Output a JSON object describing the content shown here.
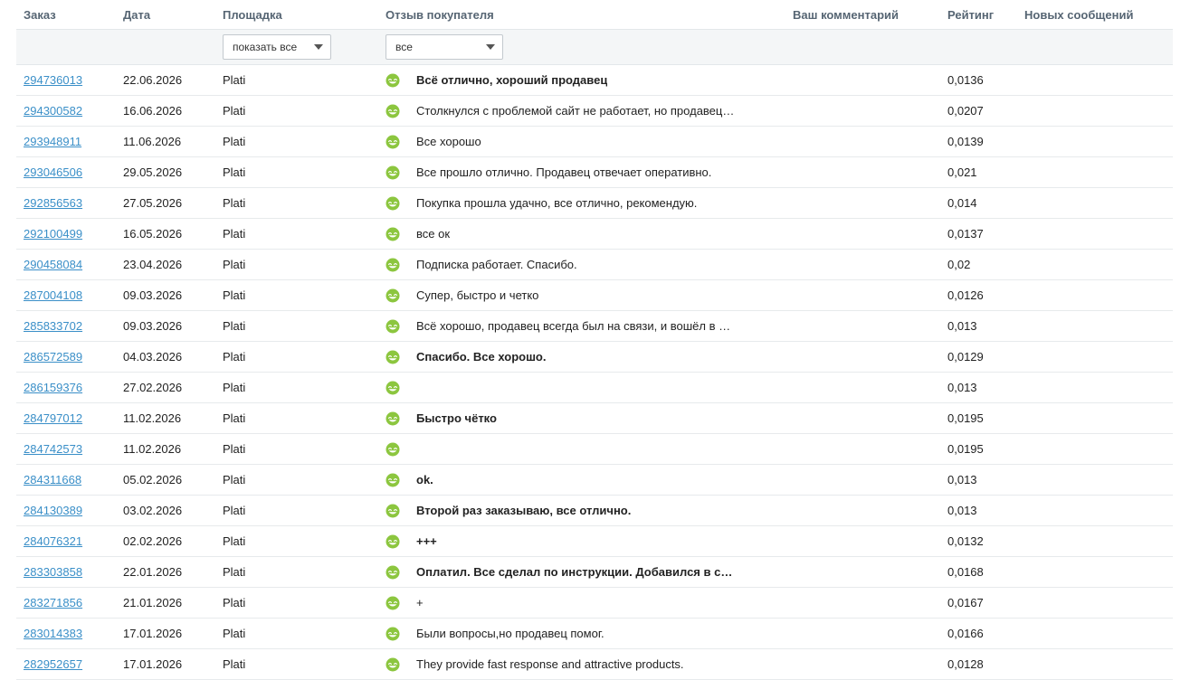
{
  "columns": {
    "order": "Заказ",
    "date": "Дата",
    "platform": "Площадка",
    "feedback": "Отзыв покупателя",
    "comment": "Ваш комментарий",
    "rating": "Рейтинг",
    "messages": "Новых сообщений"
  },
  "filters": {
    "platform": "показать все",
    "feedback": "все"
  },
  "icon": "smiley-positive-icon",
  "colors": {
    "link": "#3a8fc8",
    "smiley": "#8cc63f"
  },
  "rows": [
    {
      "order": "294736013",
      "date": "22.06.2026",
      "platform": "Plati",
      "feedback": "Всё отлично, хороший продавец",
      "bold": true,
      "rating": "0,0136"
    },
    {
      "order": "294300582",
      "date": "16.06.2026",
      "platform": "Plati",
      "feedback": "Столкнулся с проблемой сайт не работает, но продавец помог",
      "bold": false,
      "rating": "0,0207"
    },
    {
      "order": "293948911",
      "date": "11.06.2026",
      "platform": "Plati",
      "feedback": "Все хорошо",
      "bold": false,
      "rating": "0,0139"
    },
    {
      "order": "293046506",
      "date": "29.05.2026",
      "platform": "Plati",
      "feedback": "Все прошло отлично. Продавец отвечает оперативно.",
      "bold": false,
      "rating": "0,021"
    },
    {
      "order": "292856563",
      "date": "27.05.2026",
      "platform": "Plati",
      "feedback": "Покупка прошла удачно, все отлично, рекомендую.",
      "bold": false,
      "rating": "0,014"
    },
    {
      "order": "292100499",
      "date": "16.05.2026",
      "platform": "Plati",
      "feedback": "все ок",
      "bold": false,
      "rating": "0,0137"
    },
    {
      "order": "290458084",
      "date": "23.04.2026",
      "platform": "Plati",
      "feedback": "Подписка работает. Спасибо.",
      "bold": false,
      "rating": "0,02"
    },
    {
      "order": "287004108",
      "date": "09.03.2026",
      "platform": "Plati",
      "feedback": "Супер, быстро и четко",
      "bold": false,
      "rating": "0,0126"
    },
    {
      "order": "285833702",
      "date": "09.03.2026",
      "platform": "Plati",
      "feedback": "Всё хорошо, продавец всегда был на связи, и вошёл в положение",
      "bold": false,
      "rating": "0,013"
    },
    {
      "order": "286572589",
      "date": "04.03.2026",
      "platform": "Plati",
      "feedback": "Спасибо. Все хорошо.",
      "bold": true,
      "rating": "0,0129"
    },
    {
      "order": "286159376",
      "date": "27.02.2026",
      "platform": "Plati",
      "feedback": "",
      "bold": false,
      "rating": "0,013"
    },
    {
      "order": "284797012",
      "date": "11.02.2026",
      "platform": "Plati",
      "feedback": "Быстро чётко",
      "bold": true,
      "rating": "0,0195"
    },
    {
      "order": "284742573",
      "date": "11.02.2026",
      "platform": "Plati",
      "feedback": "",
      "bold": false,
      "rating": "0,0195"
    },
    {
      "order": "284311668",
      "date": "05.02.2026",
      "platform": "Plati",
      "feedback": "ok.",
      "bold": true,
      "rating": "0,013"
    },
    {
      "order": "284130389",
      "date": "03.02.2026",
      "platform": "Plati",
      "feedback": "Второй раз заказываю, все отлично.",
      "bold": true,
      "rating": "0,013"
    },
    {
      "order": "284076321",
      "date": "02.02.2026",
      "platform": "Plati",
      "feedback": "+++",
      "bold": true,
      "rating": "0,0132"
    },
    {
      "order": "283303858",
      "date": "22.01.2026",
      "platform": "Plati",
      "feedback": "Оплатил. Все сделал по инструкции. Добавился в семью.",
      "bold": true,
      "rating": "0,0168"
    },
    {
      "order": "283271856",
      "date": "21.01.2026",
      "platform": "Plati",
      "feedback": "+",
      "bold": false,
      "rating": "0,0167"
    },
    {
      "order": "283014383",
      "date": "17.01.2026",
      "platform": "Plati",
      "feedback": "Были вопросы,но продавец помог.",
      "bold": false,
      "rating": "0,0166"
    },
    {
      "order": "282952657",
      "date": "17.01.2026",
      "platform": "Plati",
      "feedback": "They provide fast response and attractive products.",
      "bold": false,
      "rating": "0,0128"
    }
  ]
}
